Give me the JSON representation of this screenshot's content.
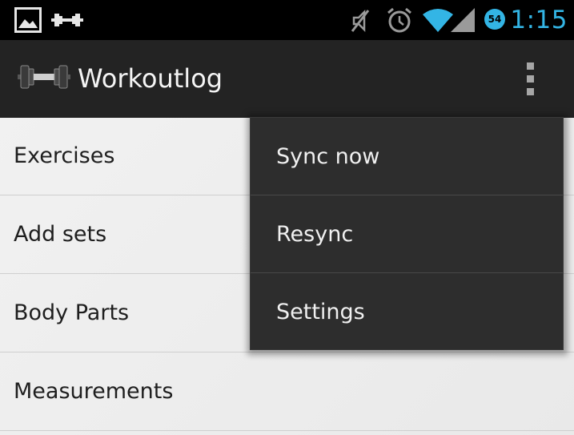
{
  "status_bar": {
    "time": "1:15",
    "battery_level": "54",
    "left_icons": [
      "image-icon",
      "dumbbell-icon"
    ],
    "right_icons": [
      "mute-icon",
      "alarm-icon",
      "wifi-icon",
      "signal-icon",
      "battery-icon"
    ],
    "clock_color": "#33b5e5"
  },
  "action_bar": {
    "app_icon": "dumbbell-icon",
    "title": "Workoutlog",
    "overflow_icon": "overflow-menu-icon",
    "background": "#232323"
  },
  "list": {
    "items": [
      {
        "label": "Exercises"
      },
      {
        "label": "Add sets"
      },
      {
        "label": "Body Parts"
      },
      {
        "label": "Measurements"
      }
    ]
  },
  "menu": {
    "items": [
      {
        "label": "Sync now"
      },
      {
        "label": "Resync"
      },
      {
        "label": "Settings"
      }
    ],
    "background": "#2d2d2d"
  }
}
